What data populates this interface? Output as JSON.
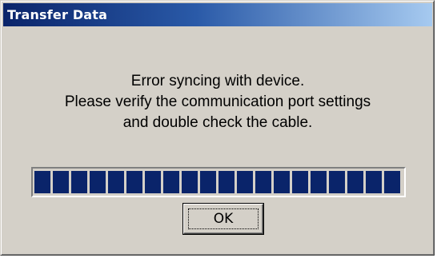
{
  "window": {
    "title": "Transfer Data"
  },
  "message": {
    "line1": "Error syncing with device.",
    "line2": "Please verify the communication port settings",
    "line3": "and double check the cable."
  },
  "progress": {
    "fraction": 1.0,
    "block_color": "#0a246a"
  },
  "buttons": {
    "ok_label": "OK"
  },
  "colors": {
    "dialog_face": "#d4d0c8",
    "title_gradient_start": "#0a246a",
    "title_gradient_end": "#a6caf0"
  }
}
